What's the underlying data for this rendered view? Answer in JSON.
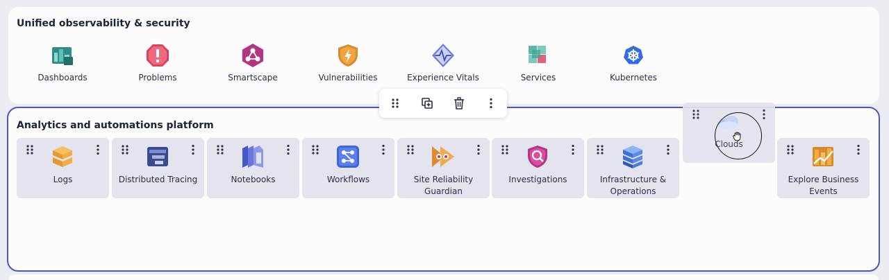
{
  "sections": {
    "top_title": "Unified observability & security",
    "main_title": "Analytics and automations platform"
  },
  "top_apps": [
    {
      "label": "Dashboards",
      "icon": "dashboards-icon"
    },
    {
      "label": "Problems",
      "icon": "problems-icon"
    },
    {
      "label": "Smartscape",
      "icon": "smartscape-icon"
    },
    {
      "label": "Vulnerabilities",
      "icon": "vulnerabilities-icon"
    },
    {
      "label": "Experience Vitals",
      "icon": "experience-vitals-icon"
    },
    {
      "label": "Services",
      "icon": "services-icon"
    },
    {
      "label": "Kubernetes",
      "icon": "kubernetes-icon"
    }
  ],
  "toolbar": {
    "drag": "drag-handle-icon",
    "duplicate": "duplicate-icon",
    "delete": "trash-icon",
    "more": "more-vertical-icon"
  },
  "tiles": [
    {
      "label": "Logs",
      "icon": "logs-icon"
    },
    {
      "label": "Distributed Tracing",
      "icon": "distributed-tracing-icon"
    },
    {
      "label": "Notebooks",
      "icon": "notebooks-icon"
    },
    {
      "label": "Workflows",
      "icon": "workflows-icon"
    },
    {
      "label": "Site Reliability Guardian",
      "icon": "site-reliability-guardian-icon"
    },
    {
      "label": "Investigations",
      "icon": "investigations-icon"
    },
    {
      "label": "Infrastructure & Operations",
      "icon": "infrastructure-operations-icon"
    },
    {
      "label": "Explore Business Events",
      "icon": "explore-business-events-icon"
    }
  ],
  "dragging_tile": {
    "label": "Clouds",
    "icon": "clouds-icon"
  },
  "colors": {
    "accent_border": "#4a55c8",
    "tile_bg": "#e3e4ee",
    "panel_bg": "#fcfcfd"
  }
}
